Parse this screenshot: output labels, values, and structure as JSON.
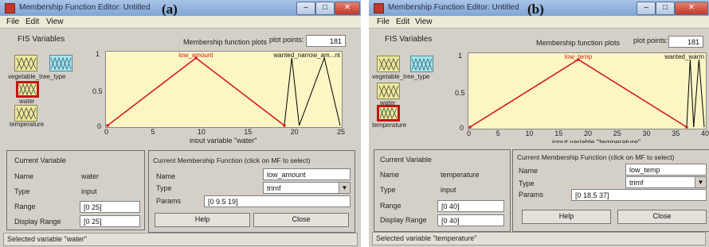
{
  "panel_a": {
    "label": "(a)",
    "title": "Membership Function Editor: Untitled",
    "menu": [
      "File",
      "Edit",
      "View"
    ],
    "fis_variables_title": "FIS Variables",
    "inputs": [
      "water",
      "temperature"
    ],
    "output_label": "vegetable_tree_type",
    "plots_title": "Membership function plots",
    "plot_points_label": "plot points:",
    "plot_points_value": "181",
    "mf_labels": [
      "low_amount",
      "wanted_narrow_am...nt"
    ],
    "x_title": "input variable \"water\"",
    "y_ticks": [
      "1",
      "0.5",
      "0"
    ],
    "x_ticks": [
      "0",
      "5",
      "10",
      "15",
      "20",
      "25"
    ],
    "current_variable_title": "Current Variable",
    "name_label": "Name",
    "name_value": "water",
    "type_label": "Type",
    "type_value": "input",
    "range_label": "Range",
    "range_value": "[0 25]",
    "display_range_label": "Display Range",
    "display_range_value": "[0 25]",
    "mf_group_title": "Current Membership Function (click on MF to select)",
    "mf_name_label": "Name",
    "mf_name_value": "low_amount",
    "mf_type_label": "Type",
    "mf_type_value": "trimf",
    "params_label": "Params",
    "params_value": "[0 9.5 19]",
    "help_label": "Help",
    "close_label": "Close",
    "status": "Selected variable \"water\""
  },
  "panel_b": {
    "label": "(b)",
    "title": "Membership Function Editor: Untitled",
    "menu": [
      "File",
      "Edit",
      "View"
    ],
    "fis_variables_title": "FIS Variables",
    "inputs": [
      "water",
      "temperature"
    ],
    "output_label": "vegetable_tree_type",
    "plots_title": "Membership function plots",
    "plot_points_label": "plot points:",
    "plot_points_value": "181",
    "mf_labels": [
      "low_temp",
      "wanted_warm"
    ],
    "x_title": "input variable \"temperature\"",
    "y_ticks": [
      "1",
      "0.5",
      "0"
    ],
    "x_ticks": [
      "0",
      "5",
      "10",
      "15",
      "20",
      "25",
      "30",
      "35",
      "40"
    ],
    "current_variable_title": "Current Variable",
    "name_label": "Name",
    "name_value": "temperature",
    "type_label": "Type",
    "type_value": "input",
    "range_label": "Range",
    "range_value": "[0 40]",
    "display_range_label": "Display Range",
    "display_range_value": "[0 40]",
    "mf_group_title": "Current Membership Function (click on MF to select)",
    "mf_name_label": "Name",
    "mf_name_value": "low_temp",
    "mf_type_label": "Type",
    "mf_type_value": "trimf",
    "params_label": "Params",
    "params_value": "[0 18.5 37]",
    "help_label": "Help",
    "close_label": "Close",
    "status": "Selected variable \"temperature\""
  },
  "plot_a": {
    "x_range": [
      0,
      25
    ],
    "main_mf": [
      0,
      9.5,
      19
    ],
    "other_mfs": [
      [
        19,
        19.8,
        20.6
      ],
      [
        20.6,
        23.3,
        25
      ]
    ]
  },
  "plot_b": {
    "x_range": [
      0,
      40
    ],
    "main_mf": [
      0,
      18.5,
      37
    ],
    "other_mfs": [
      [
        37,
        37.6,
        38.2
      ],
      [
        38.2,
        39.1,
        40
      ]
    ]
  },
  "colors": {
    "selected_mf": "#d41c1c",
    "other_mf": "#000000",
    "plot_bg": "#fbf6c4",
    "input_box": "#ece89a",
    "output_box": "#a9e4ee"
  }
}
